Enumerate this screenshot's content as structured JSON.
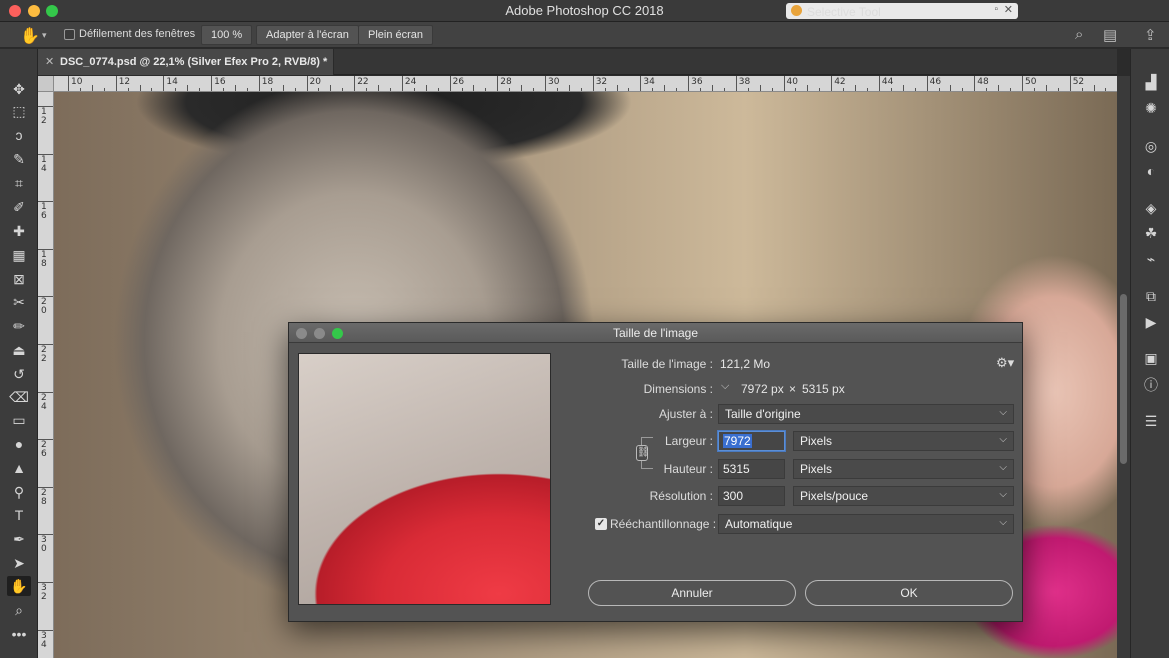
{
  "window": {
    "app_title": "Adobe Photoshop CC 2018",
    "selective_tool_label": "Selective Tool"
  },
  "options_bar": {
    "scroll_all_windows_label": "Défilement des fenêtres",
    "zoom_100_label": "100 %",
    "fit_screen_label": "Adapter à l'écran",
    "full_screen_label": "Plein écran"
  },
  "document": {
    "tab_title": "DSC_0774.psd @ 22,1% (Silver Efex Pro 2, RVB/8) *"
  },
  "rulers": {
    "top": [
      "10",
      "12",
      "14",
      "16",
      "18",
      "20",
      "22",
      "24",
      "26",
      "28",
      "30",
      "32",
      "34",
      "36",
      "38",
      "40",
      "42",
      "44",
      "46",
      "48",
      "50",
      "52"
    ],
    "left": [
      "1 2",
      "1 4",
      "1 6",
      "1 8",
      "2 0",
      "2 2",
      "2 4",
      "2 6",
      "2 8",
      "3 0",
      "3 2",
      "3 4"
    ]
  },
  "dialog": {
    "title": "Taille de l'image",
    "image_size_label": "Taille de l'image :",
    "image_size_value": "121,2 Mo",
    "dimensions_label": "Dimensions :",
    "dimensions_width": "7972 px",
    "dimensions_x": "×",
    "dimensions_height": "5315 px",
    "fit_to_label": "Ajuster à :",
    "fit_to_value": "Taille d'origine",
    "width_label": "Largeur :",
    "width_value": "7972",
    "width_unit": "Pixels",
    "height_label": "Hauteur :",
    "height_value": "5315",
    "height_unit": "Pixels",
    "resolution_label": "Résolution :",
    "resolution_value": "300",
    "resolution_unit": "Pixels/pouce",
    "resample_label": "Rééchantillonnage :",
    "resample_checked": true,
    "resample_value": "Automatique",
    "cancel_label": "Annuler",
    "ok_label": "OK"
  },
  "icons": {
    "left_tools": [
      "move-icon",
      "marquee-icon",
      "lasso-icon",
      "quick-select-icon",
      "crop-icon",
      "eyedropper-icon",
      "healing-brush-icon",
      "patch-icon",
      "frame-icon",
      "content-aware-move-icon",
      "brush-icon",
      "stamp-icon",
      "history-brush-icon",
      "eraser-icon",
      "gradient-icon",
      "blur-icon",
      "sharpen-icon",
      "dodge-icon",
      "type-icon",
      "pen-icon",
      "path-select-icon",
      "hand-icon",
      "zoom-icon",
      "more-tools-icon"
    ],
    "right_panel": [
      "histogram-icon",
      "adjustments-icon",
      "channels-icon",
      "styles-icon",
      "layers-icon",
      "color-icon",
      "paths-icon",
      "properties-icon",
      "actions-icon",
      "navigator-icon",
      "info-icon",
      "user-icon"
    ]
  }
}
